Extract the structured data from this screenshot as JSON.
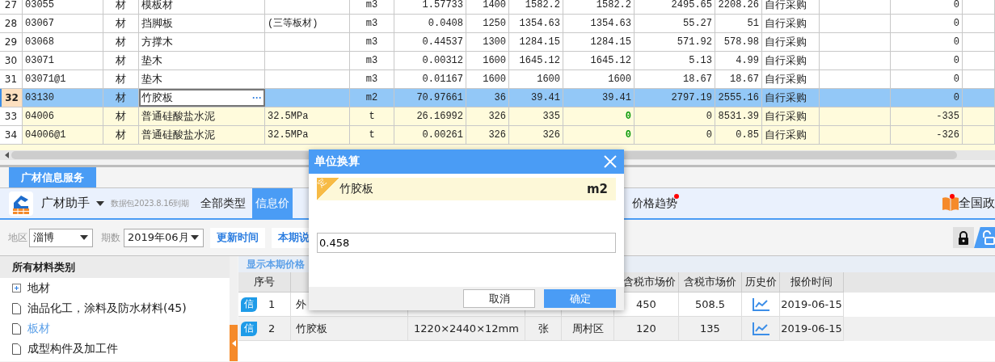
{
  "material_grid": {
    "rows": [
      {
        "number": "27",
        "cells": [
          "03055",
          "材",
          "模板材",
          null,
          "m3",
          "1.57733",
          "1400",
          "1582.2",
          "1582.2",
          "2495.65",
          "2208.26",
          "自行采购",
          null,
          "0",
          null
        ],
        "selected": false,
        "changed": false
      },
      {
        "number": "28",
        "cells": [
          "03067",
          "材",
          "挡脚板",
          "(三等板材)",
          "m3",
          "0.0408",
          "1250",
          "1354.63",
          "1354.63",
          "55.27",
          "51",
          "自行采购",
          null,
          "0",
          null
        ],
        "selected": false,
        "changed": false
      },
      {
        "number": "29",
        "cells": [
          "03068",
          "材",
          "方撑木",
          null,
          "m3",
          "0.44537",
          "1300",
          "1284.15",
          "1284.15",
          "571.92",
          "578.98",
          "自行采购",
          null,
          "0",
          null
        ],
        "selected": false,
        "changed": false
      },
      {
        "number": "30",
        "cells": [
          "03071",
          "材",
          "垫木",
          null,
          "m3",
          "0.00312",
          "1600",
          "1645.12",
          "1645.12",
          "5.13",
          "4.99",
          "自行采购",
          null,
          "0",
          null
        ],
        "selected": false,
        "changed": false
      },
      {
        "number": "31",
        "cells": [
          "03071@1",
          "材",
          "垫木",
          null,
          "m3",
          "0.01167",
          "1600",
          "1600",
          "1600",
          "18.67",
          "18.67",
          "自行采购",
          null,
          "0",
          null
        ],
        "selected": false,
        "changed": false
      },
      {
        "number": "32",
        "cells": [
          "03130",
          "材",
          "竹胶板",
          null,
          "m2",
          "70.97661",
          "36",
          "39.41",
          "39.41",
          "2797.19",
          "2555.16",
          "自行采购",
          null,
          "0",
          null
        ],
        "selected": true,
        "changed": false,
        "edit_button": "···"
      },
      {
        "number": "33",
        "cells": [
          "04006",
          "材",
          "普通硅酸盐水泥",
          "32.5MPa",
          "t",
          "26.16992",
          "326",
          "335",
          "0",
          "0",
          "8531.39",
          "自行采购",
          null,
          "-335",
          null
        ],
        "selected": false,
        "changed": true
      },
      {
        "number": "34",
        "cells": [
          "04006@1",
          "材",
          "普通硅酸盐水泥",
          "32.5MPa",
          "t",
          "0.00261",
          "326",
          "326",
          "0",
          "0",
          "0.85",
          "自行采购",
          null,
          "-326",
          null
        ],
        "selected": false,
        "changed": true
      }
    ]
  },
  "panel_tabs": [
    {
      "label": "广材信息服务",
      "selected": true
    }
  ],
  "toolbar": {
    "app_name": "广材助手",
    "package_note": "数据包2023.8.16到期",
    "tabs": [
      {
        "label": "全部类型",
        "selected": false,
        "badge": false
      },
      {
        "label": "信息价",
        "selected": true,
        "badge": false
      },
      {
        "label": "价格趋势",
        "selected": false,
        "badge": true
      }
    ],
    "policy_link": {
      "label": "全国政",
      "badge": true
    }
  },
  "filters": {
    "region_label": "地区",
    "region": "淄博",
    "period_label": "期数",
    "period": "2019年06月",
    "buttons": [
      "更新时间",
      "本期说"
    ]
  },
  "categories": {
    "title": "所有材料类别",
    "items": [
      {
        "label": "地材",
        "kind": "group",
        "selected": false
      },
      {
        "label": "油品化工，涂料及防水材料(45)",
        "kind": "leaf",
        "selected": false
      },
      {
        "label": "板材",
        "kind": "leaf",
        "selected": true
      },
      {
        "label": "成型构件及加工件",
        "kind": "leaf",
        "selected": false
      }
    ]
  },
  "price_list": {
    "link": "显示本期价格",
    "columns": [
      "序号",
      null,
      null,
      null,
      null,
      "含税市场价",
      "含税市场价",
      "历史价",
      "报价时间"
    ],
    "rows": [
      {
        "badge": "信",
        "cells": [
          "1",
          "外",
          null,
          null,
          null,
          "450",
          "508.5"
        ],
        "date": "2019-06-15"
      },
      {
        "badge": "信",
        "cells": [
          "2",
          "竹胶板",
          "1220×2440×12mm",
          "张",
          "周村区",
          "120",
          "135"
        ],
        "date": "2019-06-15"
      }
    ]
  },
  "dialog": {
    "title": "单位换算",
    "tag": "定",
    "material": "竹胶板",
    "unit": "m2",
    "value": "0.458",
    "buttons": [
      {
        "label": "取消",
        "kind": "secondary"
      },
      {
        "label": "确定",
        "kind": "primary"
      }
    ]
  }
}
